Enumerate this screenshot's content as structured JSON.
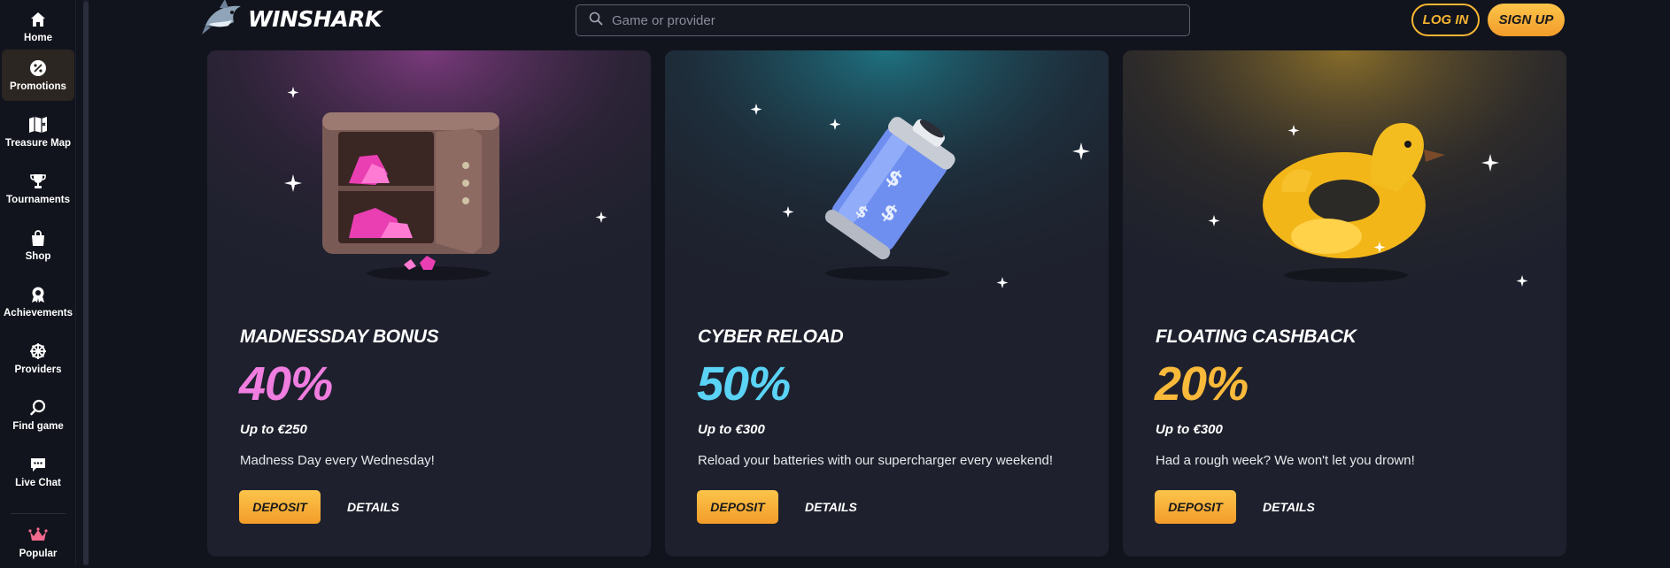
{
  "brand": {
    "name": "WINSHARK",
    "accent": "#f7b532"
  },
  "search": {
    "placeholder": "Game or provider"
  },
  "auth": {
    "login_label": "LOG IN",
    "signup_label": "SIGN UP"
  },
  "sidebar": {
    "items": [
      {
        "label": "Home",
        "icon": "home-icon"
      },
      {
        "label": "Promotions",
        "icon": "percent-icon",
        "active": true
      },
      {
        "label": "Treasure Map",
        "icon": "map-icon"
      },
      {
        "label": "Tournaments",
        "icon": "trophy-icon"
      },
      {
        "label": "Shop",
        "icon": "shopping-bag-icon"
      },
      {
        "label": "Achievements",
        "icon": "award-icon"
      },
      {
        "label": "Providers",
        "icon": "wheel-icon"
      },
      {
        "label": "Find game",
        "icon": "search-icon"
      },
      {
        "label": "Live Chat",
        "icon": "chat-icon"
      },
      {
        "label": "Popular",
        "icon": "crown-icon"
      }
    ]
  },
  "promotions": [
    {
      "title": "MADNESSDAY BONUS",
      "percent": "40%",
      "up_to": "Up to €250",
      "description": "Madness Day every Wednesday!",
      "deposit_label": "DEPOSIT",
      "details_label": "DETAILS",
      "color": "#f07de0",
      "art": "safe-icon"
    },
    {
      "title": "CYBER RELOAD",
      "percent": "50%",
      "up_to": "Up to €300",
      "description": "Reload your batteries with our supercharger every weekend!",
      "deposit_label": "DEPOSIT",
      "details_label": "DETAILS",
      "color": "#5ad3f5",
      "art": "battery-icon"
    },
    {
      "title": "FLOATING CASHBACK",
      "percent": "20%",
      "up_to": "Up to €300",
      "description": "Had a rough week? We won't let you drown!",
      "deposit_label": "DEPOSIT",
      "details_label": "DETAILS",
      "color": "#f9b93a",
      "art": "duck-float-icon"
    }
  ]
}
